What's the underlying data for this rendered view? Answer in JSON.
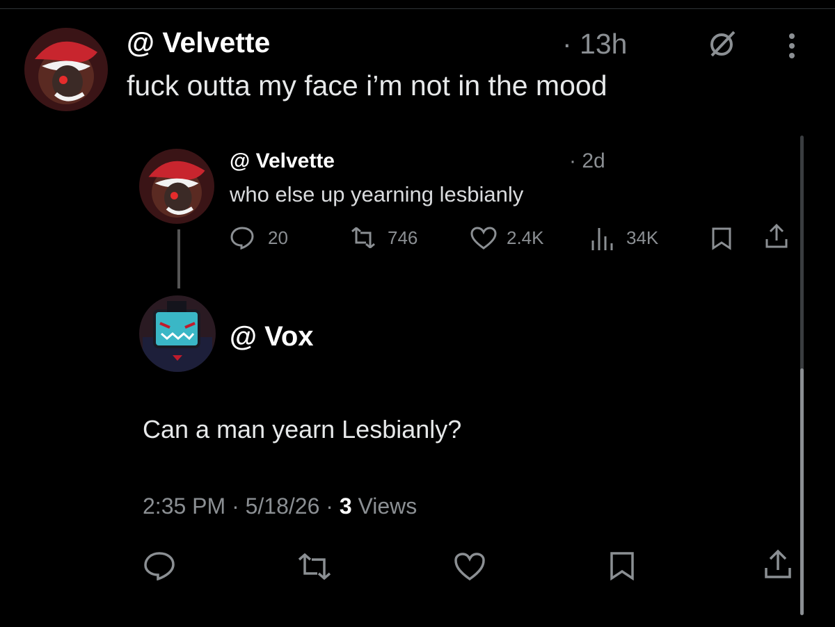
{
  "main_post": {
    "handle": "@ Velvette",
    "time": "· 13h",
    "text": "fuck outta my face i’m not in the mood"
  },
  "quoted_post": {
    "handle": "@ Velvette",
    "time": "· 2d",
    "text": "who else up yearning lesbianly",
    "replies": "20",
    "reposts": "746",
    "likes": "2.4K",
    "views": "34K"
  },
  "reply_post": {
    "handle": "@ Vox",
    "text": "Can a man yearn Lesbianly?",
    "timestamp": "2:35 PM · 5/18/26 · ",
    "views_count": "3",
    "views_label": " Views"
  },
  "colors": {
    "background": "#000000",
    "text": "#e7e9ea",
    "muted": "#8b8f93",
    "velvette_red": "#c8252e",
    "vox_cyan": "#3ab7c6"
  },
  "icons": [
    "grok-icon",
    "more-icon",
    "reply-icon",
    "repost-icon",
    "like-icon",
    "views-icon",
    "bookmark-icon",
    "share-icon"
  ]
}
